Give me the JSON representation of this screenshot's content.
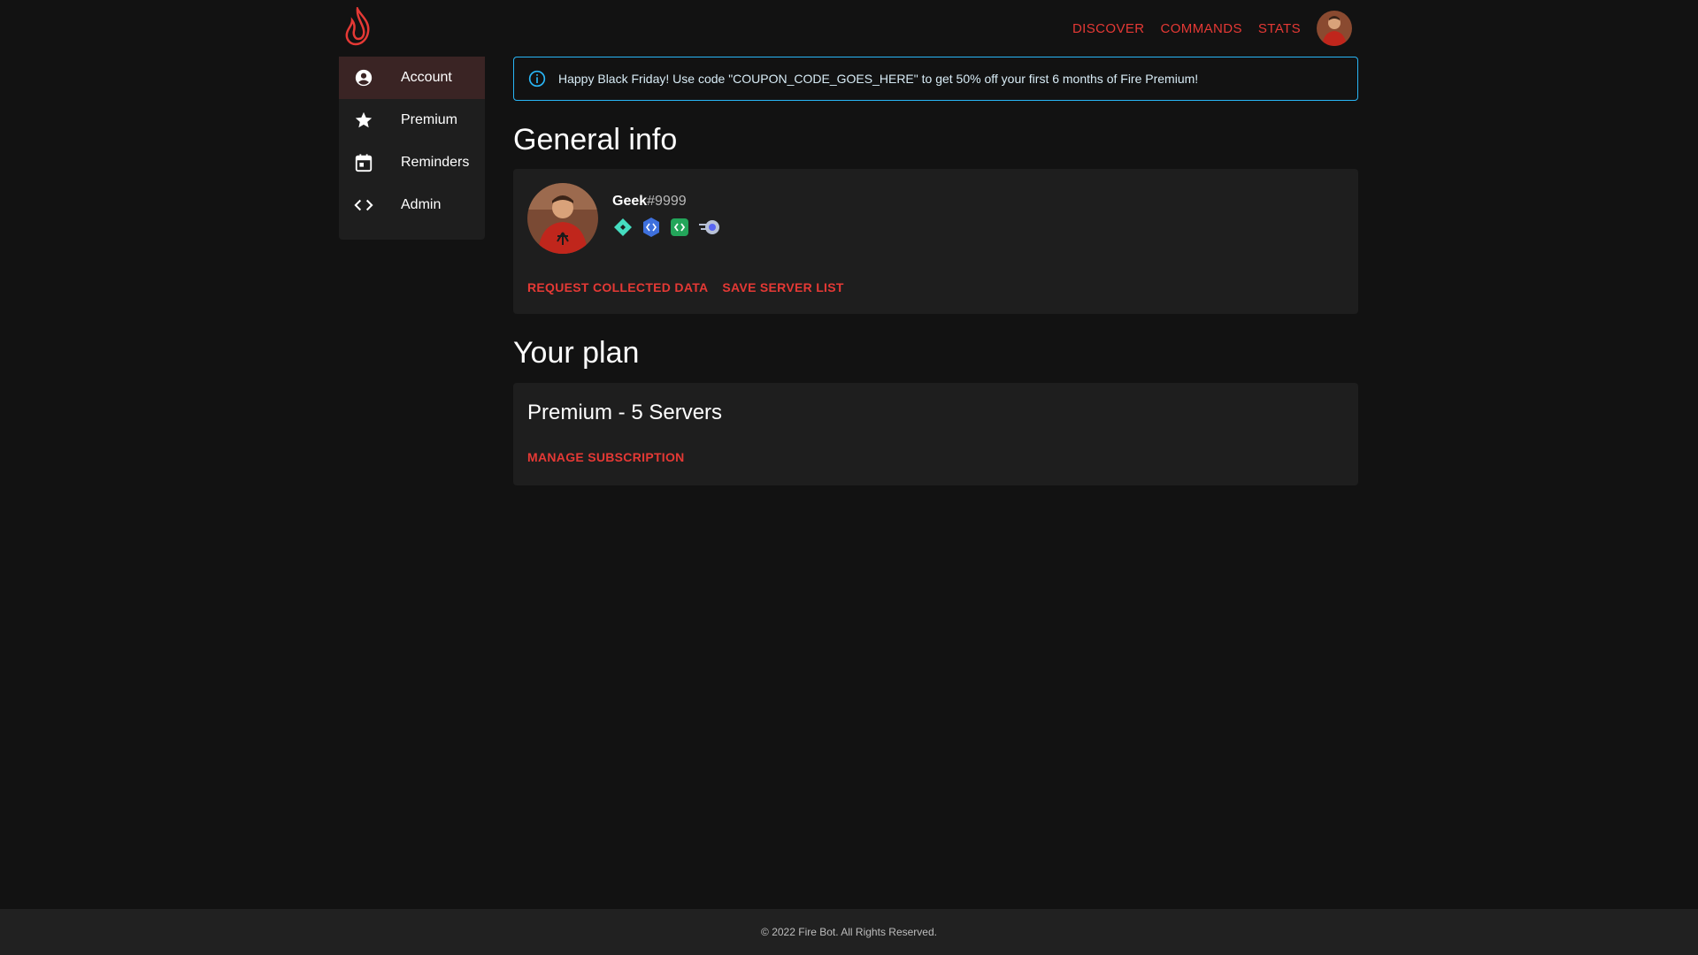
{
  "header": {
    "logo_icon": "flame-icon",
    "nav": [
      {
        "label": "DISCOVER"
      },
      {
        "label": "COMMANDS"
      },
      {
        "label": "STATS"
      }
    ],
    "accent_color": "#e53935"
  },
  "sidebar": {
    "items": [
      {
        "label": "Account",
        "icon": "account-circle-icon",
        "active": true
      },
      {
        "label": "Premium",
        "icon": "star-icon"
      },
      {
        "label": "Reminders",
        "icon": "calendar-icon"
      },
      {
        "label": "Admin",
        "icon": "code-icon"
      }
    ]
  },
  "alert": {
    "icon": "info-icon",
    "text": "Happy Black Friday! Use code \"COUPON_CODE_GOES_HERE\" to get 50% off your first 6 months of Fire Premium!",
    "color": "#29b6f6"
  },
  "general_info": {
    "title": "General info",
    "username": "Geek",
    "discriminator": "#9999",
    "badges": [
      "hypesquad-balance-icon",
      "verified-developer-icon",
      "active-developer-icon",
      "nitro-icon"
    ],
    "actions": {
      "request_data": "REQUEST COLLECTED DATA",
      "save_servers": "SAVE SERVER LIST"
    }
  },
  "plan": {
    "title": "Your plan",
    "name": "Premium - 5 Servers",
    "manage": "MANAGE SUBSCRIPTION"
  },
  "footer": {
    "text": "© 2022 Fire Bot. All Rights Reserved."
  }
}
